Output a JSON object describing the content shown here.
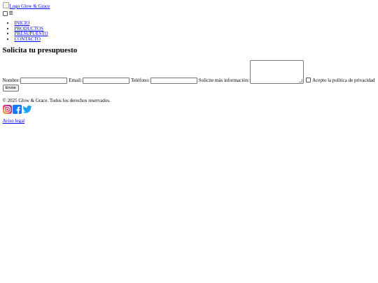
{
  "header": {
    "logo_alt": "Logo Glow & Grace",
    "menu_toggle_glyph": "☰"
  },
  "nav": {
    "items": [
      {
        "label": "INICIO"
      },
      {
        "label": "PRODUCTOS"
      },
      {
        "label": "PRESUPUESTO"
      },
      {
        "label": "CONTACTO"
      }
    ]
  },
  "main": {
    "title": "Solicita tu presupuesto",
    "form": {
      "name_label": "Nombre:",
      "email_label": "Email:",
      "phone_label": "Teléfono:",
      "info_label": "Solicite más información:",
      "privacy_label": "Acepto la política de privacidad",
      "submit_label": "Enviar"
    }
  },
  "footer": {
    "copyright": "© 2025 Glow & Grace. Todos los derechos reservados.",
    "social_icons": [
      "instagram-icon",
      "facebook-icon",
      "twitter-icon"
    ],
    "legal_link": "Aviso legal",
    "colors": {
      "instagram": "#d6249f",
      "facebook": "#1877f2",
      "twitter": "#1da1f2"
    }
  }
}
